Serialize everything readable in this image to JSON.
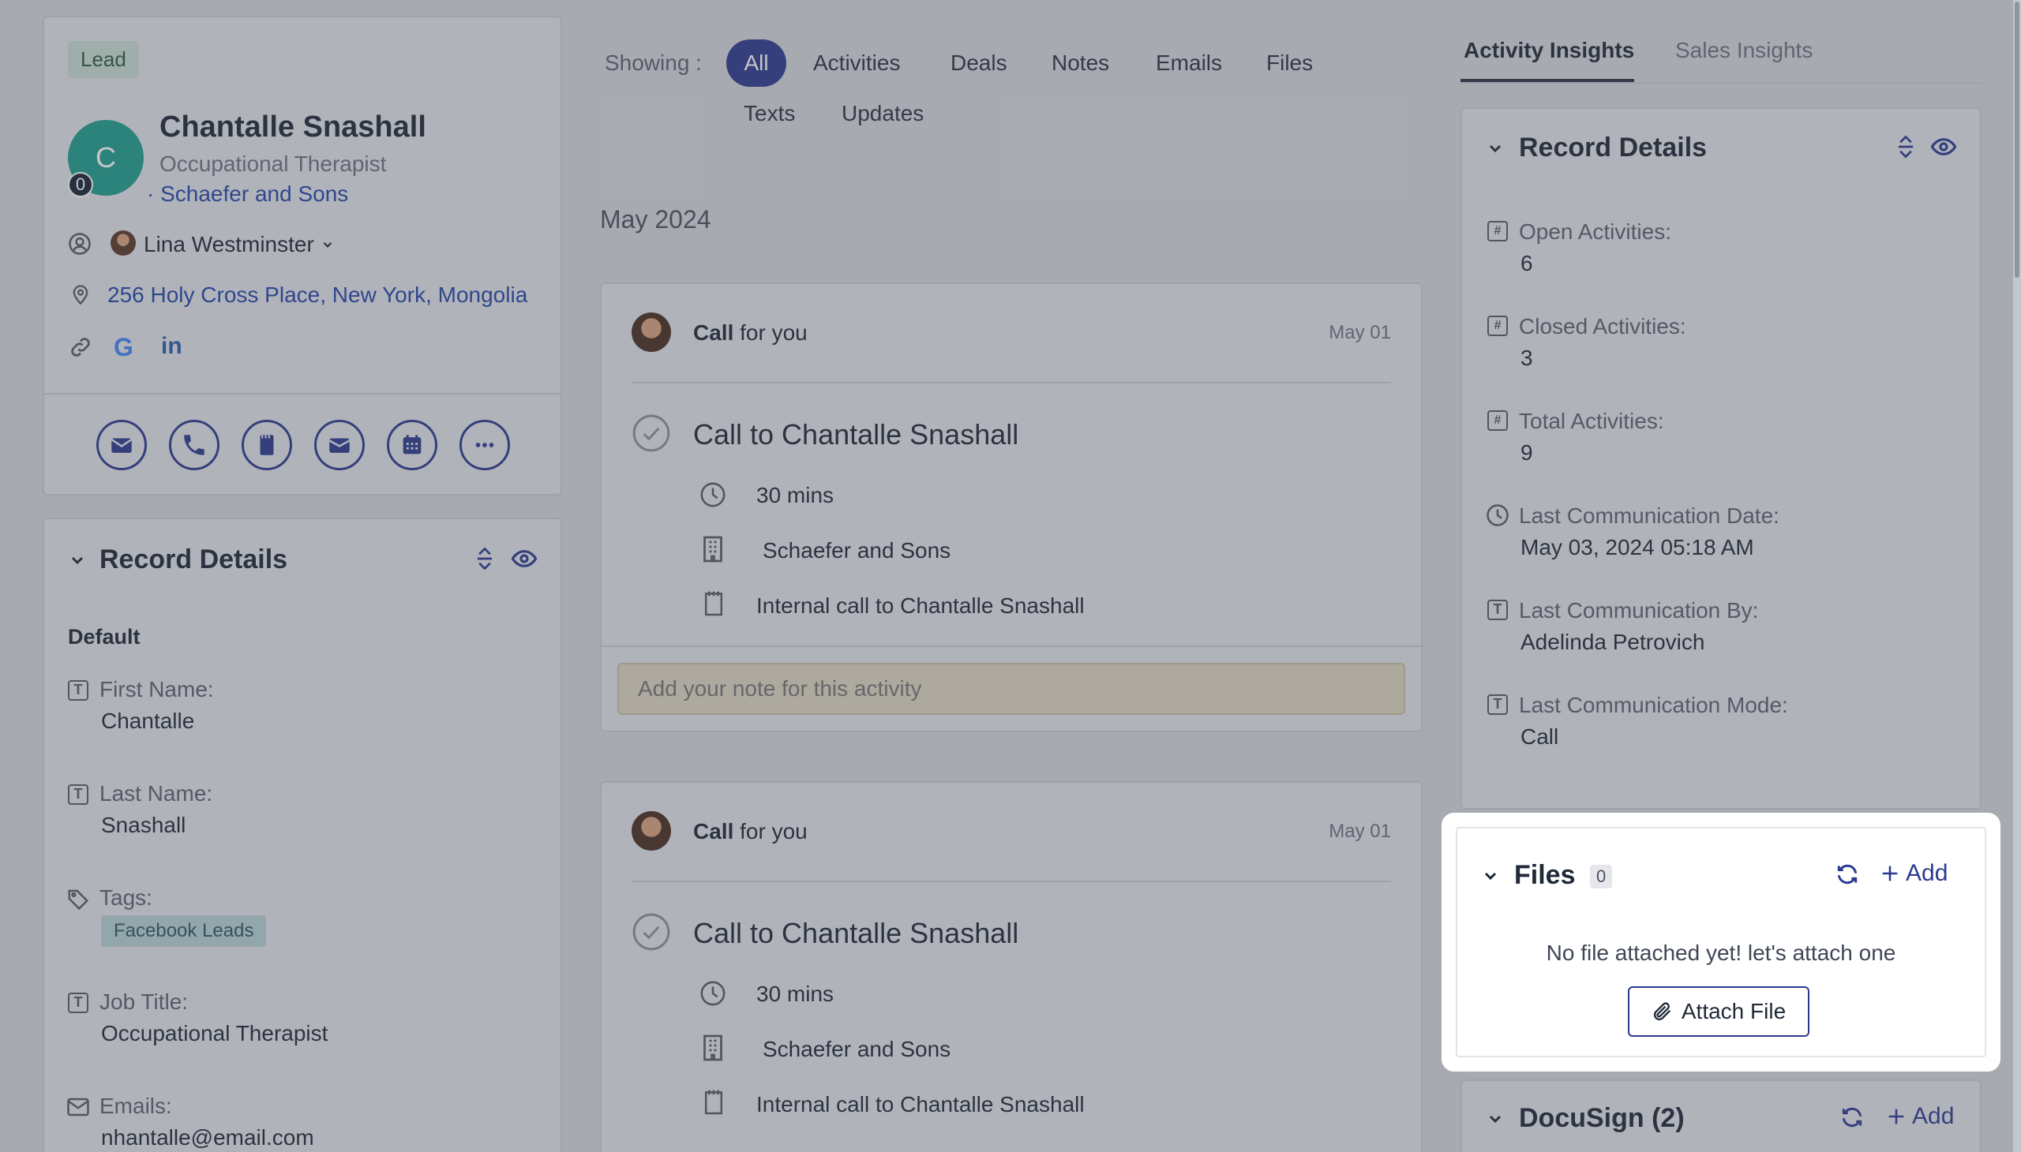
{
  "profile": {
    "badge": "Lead",
    "avatar_letter": "C",
    "avatar_count": "0",
    "name": "Chantalle Snashall",
    "job_title": "Occupational Therapist",
    "company_prefix": "·",
    "company": "Schaefer and Sons",
    "owner": "Lina Westminster",
    "address": "256 Holy Cross Place, New York, Mongolia",
    "social_icons": [
      "link-icon",
      "google-icon",
      "linkedin-icon"
    ],
    "actions": [
      "email-icon",
      "phone-icon",
      "note-icon",
      "email-alt-icon",
      "calendar-icon",
      "more-icon"
    ]
  },
  "left_record": {
    "title": "Record Details",
    "group": "Default",
    "fields": [
      {
        "label": "First Name:",
        "value": "Chantalle"
      },
      {
        "label": "Last Name:",
        "value": "Snashall"
      },
      {
        "label": "Tags:",
        "value": "Facebook Leads"
      },
      {
        "label": "Job Title:",
        "value": "Occupational Therapist"
      },
      {
        "label": "Emails:",
        "value": "nhantalle@email.com"
      }
    ]
  },
  "timeline": {
    "showing_label": "Showing :",
    "filters": [
      "All",
      "Activities",
      "Deals",
      "Notes",
      "Emails",
      "Files",
      "Texts",
      "Updates"
    ],
    "month": "May 2024",
    "activities": [
      {
        "header_bold": "Call",
        "header_rest": "for you",
        "date": "May 01",
        "title": "Call to Chantalle Snashall",
        "duration": "30 mins",
        "company": "Schaefer and Sons",
        "description": "Internal call to Chantalle Snashall",
        "note_placeholder": "Add your note for this activity"
      },
      {
        "header_bold": "Call",
        "header_rest": "for you",
        "date": "May 01",
        "title": "Call to Chantalle Snashall",
        "duration": "30 mins",
        "company": "Schaefer and Sons",
        "description": "Internal call to Chantalle Snashall"
      }
    ]
  },
  "insights": {
    "tabs": [
      "Activity Insights",
      "Sales Insights"
    ],
    "record_title": "Record Details",
    "fields": [
      {
        "label": "Open Activities:",
        "value": "6",
        "icon": "hash-icon"
      },
      {
        "label": "Closed Activities:",
        "value": "3",
        "icon": "hash-icon"
      },
      {
        "label": "Total Activities:",
        "value": "9",
        "icon": "hash-icon"
      },
      {
        "label": "Last Communication Date:",
        "value": "May 03, 2024 05:18 AM",
        "icon": "clock-icon"
      },
      {
        "label": "Last Communication By:",
        "value": "Adelinda Petrovich",
        "icon": "text-icon"
      },
      {
        "label": "Last Communication Mode:",
        "value": "Call",
        "icon": "text-icon"
      }
    ]
  },
  "files": {
    "title": "Files",
    "count": "0",
    "add_label": "Add",
    "empty_text": "No file attached yet! let's attach one",
    "attach_label": "Attach File"
  },
  "docusign": {
    "title": "DocuSign (2)",
    "add_label": "Add"
  },
  "colors": {
    "accent": "#2b3a8f",
    "avatar": "#1f9e8e",
    "lead_badge": "#cfe7d9",
    "tag_bg": "#c8e3e6",
    "link": "#2446a8"
  }
}
